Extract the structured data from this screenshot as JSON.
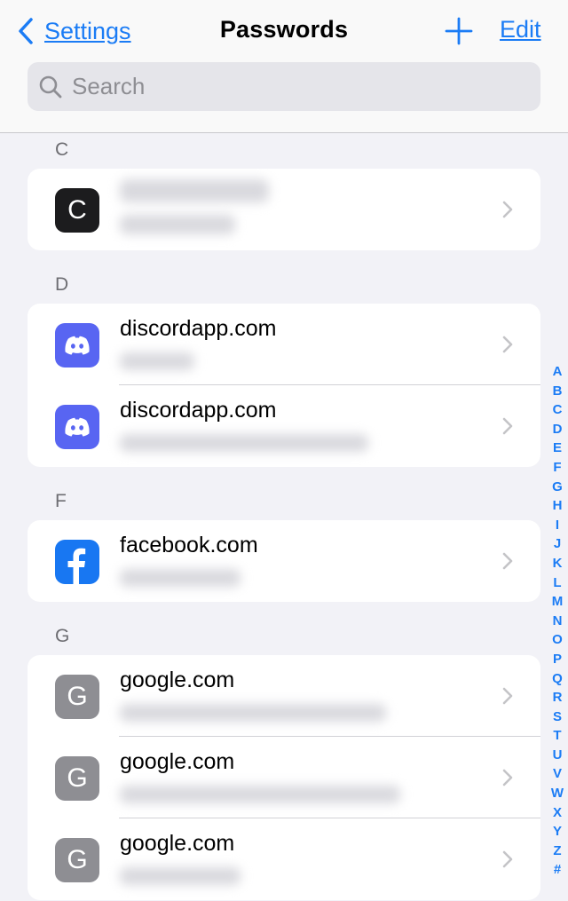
{
  "nav": {
    "back_label": "Settings",
    "title": "Passwords",
    "edit_label": "Edit"
  },
  "search": {
    "placeholder": "Search"
  },
  "sections": [
    {
      "letter": "C",
      "rows": [
        {
          "site": "",
          "icon_letter": "C"
        }
      ]
    },
    {
      "letter": "D",
      "rows": [
        {
          "site": "discordapp.com"
        },
        {
          "site": "discordapp.com"
        }
      ]
    },
    {
      "letter": "F",
      "rows": [
        {
          "site": "facebook.com"
        }
      ]
    },
    {
      "letter": "G",
      "rows": [
        {
          "site": "google.com",
          "icon_letter": "G"
        },
        {
          "site": "google.com",
          "icon_letter": "G"
        },
        {
          "site": "google.com",
          "icon_letter": "G"
        }
      ]
    }
  ],
  "index_letters": [
    "A",
    "B",
    "C",
    "D",
    "E",
    "F",
    "G",
    "H",
    "I",
    "J",
    "K",
    "L",
    "M",
    "N",
    "O",
    "P",
    "Q",
    "R",
    "S",
    "T",
    "U",
    "V",
    "W",
    "X",
    "Y",
    "Z",
    "#"
  ],
  "colors": {
    "accent": "#1b7cf5",
    "background": "#f2f2f7",
    "discord": "#5865f2",
    "facebook": "#1877f2"
  }
}
